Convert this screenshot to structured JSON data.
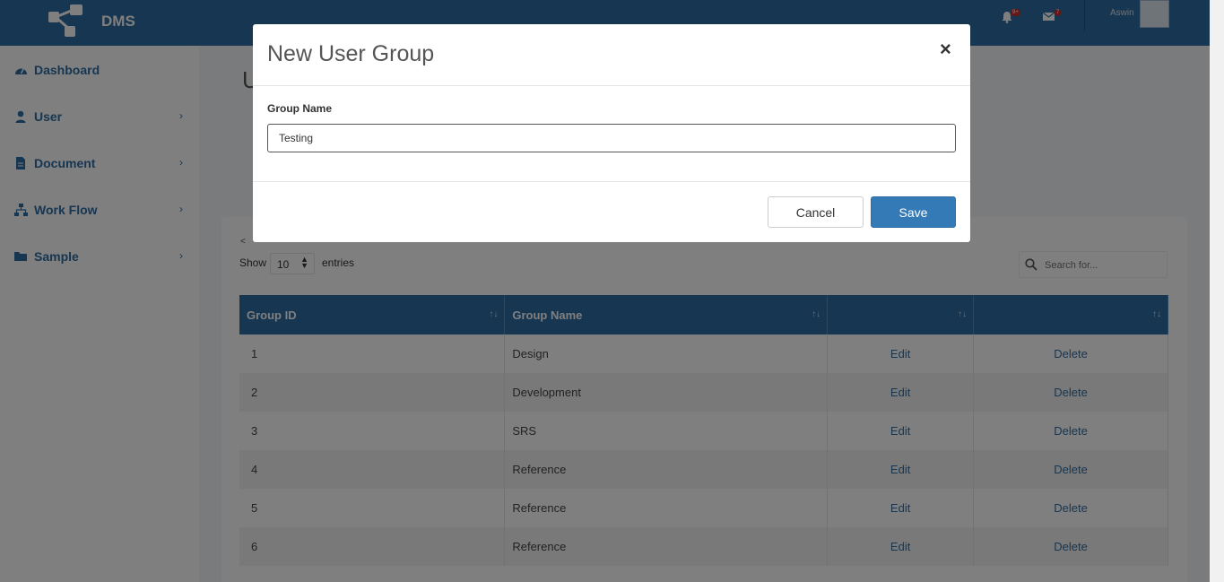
{
  "app": {
    "brand": "DMS",
    "username": "Aswin"
  },
  "header": {
    "notifications_badge": "9+",
    "messages_badge": "7",
    "icons": [
      "logo-icon",
      "bell-icon",
      "envelope-icon",
      "avatar"
    ]
  },
  "sidebar": {
    "items": [
      {
        "label": "Dashboard",
        "icon": "dashboard-icon",
        "has_submenu": false
      },
      {
        "label": "User",
        "icon": "user-icon",
        "has_submenu": true
      },
      {
        "label": "Document",
        "icon": "document-icon",
        "has_submenu": true
      },
      {
        "label": "Work Flow",
        "icon": "sitemap-icon",
        "has_submenu": true
      },
      {
        "label": "Sample",
        "icon": "folder-icon",
        "has_submenu": true
      }
    ]
  },
  "page": {
    "title_partial": "U",
    "back_link": "<",
    "show_label": "Show",
    "page_size": "10",
    "entries_label": "entries",
    "search_placeholder": "Search for..."
  },
  "table": {
    "columns": [
      "Group ID",
      "Group Name",
      "",
      ""
    ],
    "rows": [
      {
        "id": "1",
        "name": "Design",
        "edit": "Edit",
        "delete": "Delete"
      },
      {
        "id": "2",
        "name": "Development",
        "edit": "Edit",
        "delete": "Delete"
      },
      {
        "id": "3",
        "name": "SRS",
        "edit": "Edit",
        "delete": "Delete"
      },
      {
        "id": "4",
        "name": "Reference",
        "edit": "Edit",
        "delete": "Delete"
      },
      {
        "id": "5",
        "name": "Reference",
        "edit": "Edit",
        "delete": "Delete"
      },
      {
        "id": "6",
        "name": "Reference",
        "edit": "Edit",
        "delete": "Delete"
      }
    ]
  },
  "modal": {
    "title": "New User Group",
    "close": "×",
    "field_label": "Group Name",
    "field_value": "Testing",
    "cancel_label": "Cancel",
    "save_label": "Save"
  },
  "colors": {
    "primary": "#2e6da4",
    "save_button": "#337ab7",
    "badge": "#c9302c"
  }
}
